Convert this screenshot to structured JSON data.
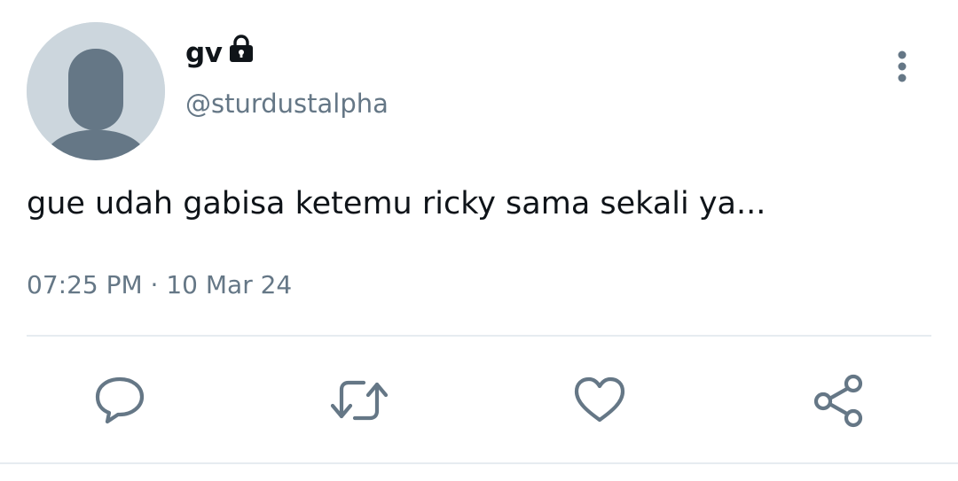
{
  "tweet": {
    "display_name": "gv",
    "handle": "@sturdustalpha",
    "text": "gue udah gabisa ketemu ricky sama sekali ya...",
    "time": "07:25 PM",
    "separator": "·",
    "date": "10 Mar 24",
    "protected": true
  },
  "icons": {
    "avatar": "default-avatar-icon",
    "lock": "lock-icon",
    "more": "more-vertical-icon",
    "reply": "reply-icon",
    "retweet": "retweet-icon",
    "like": "heart-icon",
    "share": "share-icon"
  },
  "colors": {
    "text": "#0f1419",
    "secondary": "#657786",
    "icon": "#657786",
    "avatar_bg": "#ccd6dd",
    "avatar_fg": "#657786",
    "divider": "#e6ecf0"
  }
}
